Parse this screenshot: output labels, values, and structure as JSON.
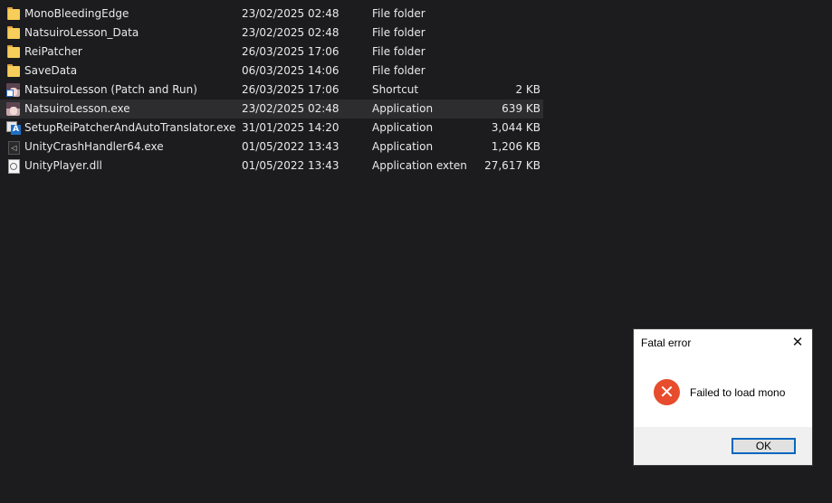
{
  "files": [
    {
      "name": "MonoBleedingEdge",
      "date": "23/02/2025 02:48",
      "type": "File folder",
      "size": "",
      "icon": "folder-icon"
    },
    {
      "name": "NatsuiroLesson_Data",
      "date": "23/02/2025 02:48",
      "type": "File folder",
      "size": "",
      "icon": "folder-icon"
    },
    {
      "name": "ReiPatcher",
      "date": "26/03/2025 17:06",
      "type": "File folder",
      "size": "",
      "icon": "folder-icon"
    },
    {
      "name": "SaveData",
      "date": "06/03/2025 14:06",
      "type": "File folder",
      "size": "",
      "icon": "folder-icon"
    },
    {
      "name": "NatsuiroLesson (Patch and Run)",
      "date": "26/03/2025 17:06",
      "type": "Shortcut",
      "size": "2 KB",
      "icon": "shortcut-icon"
    },
    {
      "name": "NatsuiroLesson.exe",
      "date": "23/02/2025 02:48",
      "type": "Application",
      "size": "639 KB",
      "icon": "game-app-icon"
    },
    {
      "name": "SetupReiPatcherAndAutoTranslator.exe",
      "date": "31/01/2025 14:20",
      "type": "Application",
      "size": "3,044 KB",
      "icon": "setup-app-icon"
    },
    {
      "name": "UnityCrashHandler64.exe",
      "date": "01/05/2022 13:43",
      "type": "Application",
      "size": "1,206 KB",
      "icon": "unity-app-icon"
    },
    {
      "name": "UnityPlayer.dll",
      "date": "01/05/2022 13:43",
      "type": "Application exten...",
      "size": "27,617 KB",
      "icon": "dll-icon"
    }
  ],
  "dialog": {
    "title": "Fatal error",
    "message": "Failed to load mono",
    "ok_label": "OK",
    "close_glyph": "✕",
    "error_glyph": "✕"
  },
  "colors": {
    "background": "#1c1c1f",
    "selected_row": "#2d2d30",
    "error_red": "#e74c2c",
    "ok_border": "#0067c0"
  }
}
